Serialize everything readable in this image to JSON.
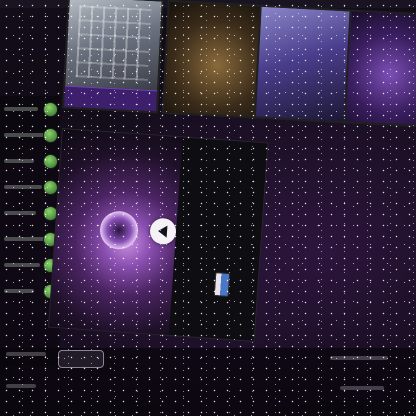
{
  "header": {
    "title": ""
  },
  "thumbnails": [
    {
      "caption": ""
    },
    {
      "caption": ""
    },
    {
      "date": ""
    },
    {
      "caption": ""
    }
  ],
  "player": {
    "heading": "",
    "subheading": ""
  },
  "side_panel": {
    "caption": ""
  },
  "footer": {
    "button_label": ""
  }
}
